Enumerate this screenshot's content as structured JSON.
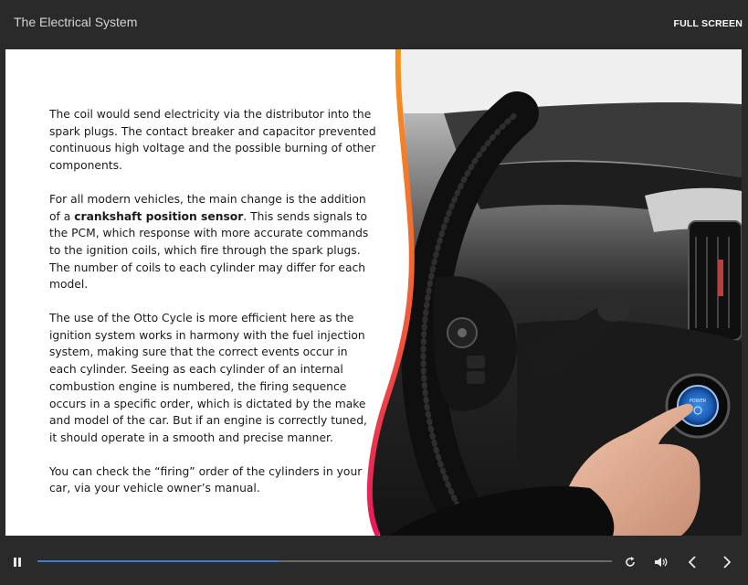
{
  "header": {
    "title": "The Electrical System",
    "fullscreen_label": "FULL SCREEN"
  },
  "slide": {
    "p1": "The coil would send electricity via the distributor into the spark plugs. The contact breaker and capacitor prevented continuous high voltage and the possible burning of other components.",
    "p2_before": "For all modern vehicles, the main change is the addition of a ",
    "p2_bold": "crankshaft position sensor",
    "p2_after": ". This sends signals to the PCM, which response with more accurate commands to the ignition coils, which fire through the spark plugs. The number of coils to each cylinder may differ for each model.",
    "p3": "The use of the Otto Cycle is more efficient here as the ignition system works in harmony with the fuel injection system, making sure that the correct events occur in each cylinder. Seeing as each cylinder of an internal combustion engine is numbered, the firing sequence occurs in a specific order, which is dictated by the make and model of the car. But if an engine is correctly tuned, it should operate in a smooth and precise manner.",
    "p4": "You can check the “firing” order of the cylinders in your car, via your vehicle owner’s manual.",
    "button_text": "POWER"
  },
  "player": {
    "progress_percent": 42,
    "icons": [
      "pause-icon",
      "replay-icon",
      "volume-icon",
      "previous-icon",
      "next-icon"
    ]
  },
  "colors": {
    "accent_gradient_top": "#f7941d",
    "accent_gradient_bottom": "#e8185c",
    "progress": "#3d7bd4",
    "bar_background": "#2a2a2a"
  }
}
